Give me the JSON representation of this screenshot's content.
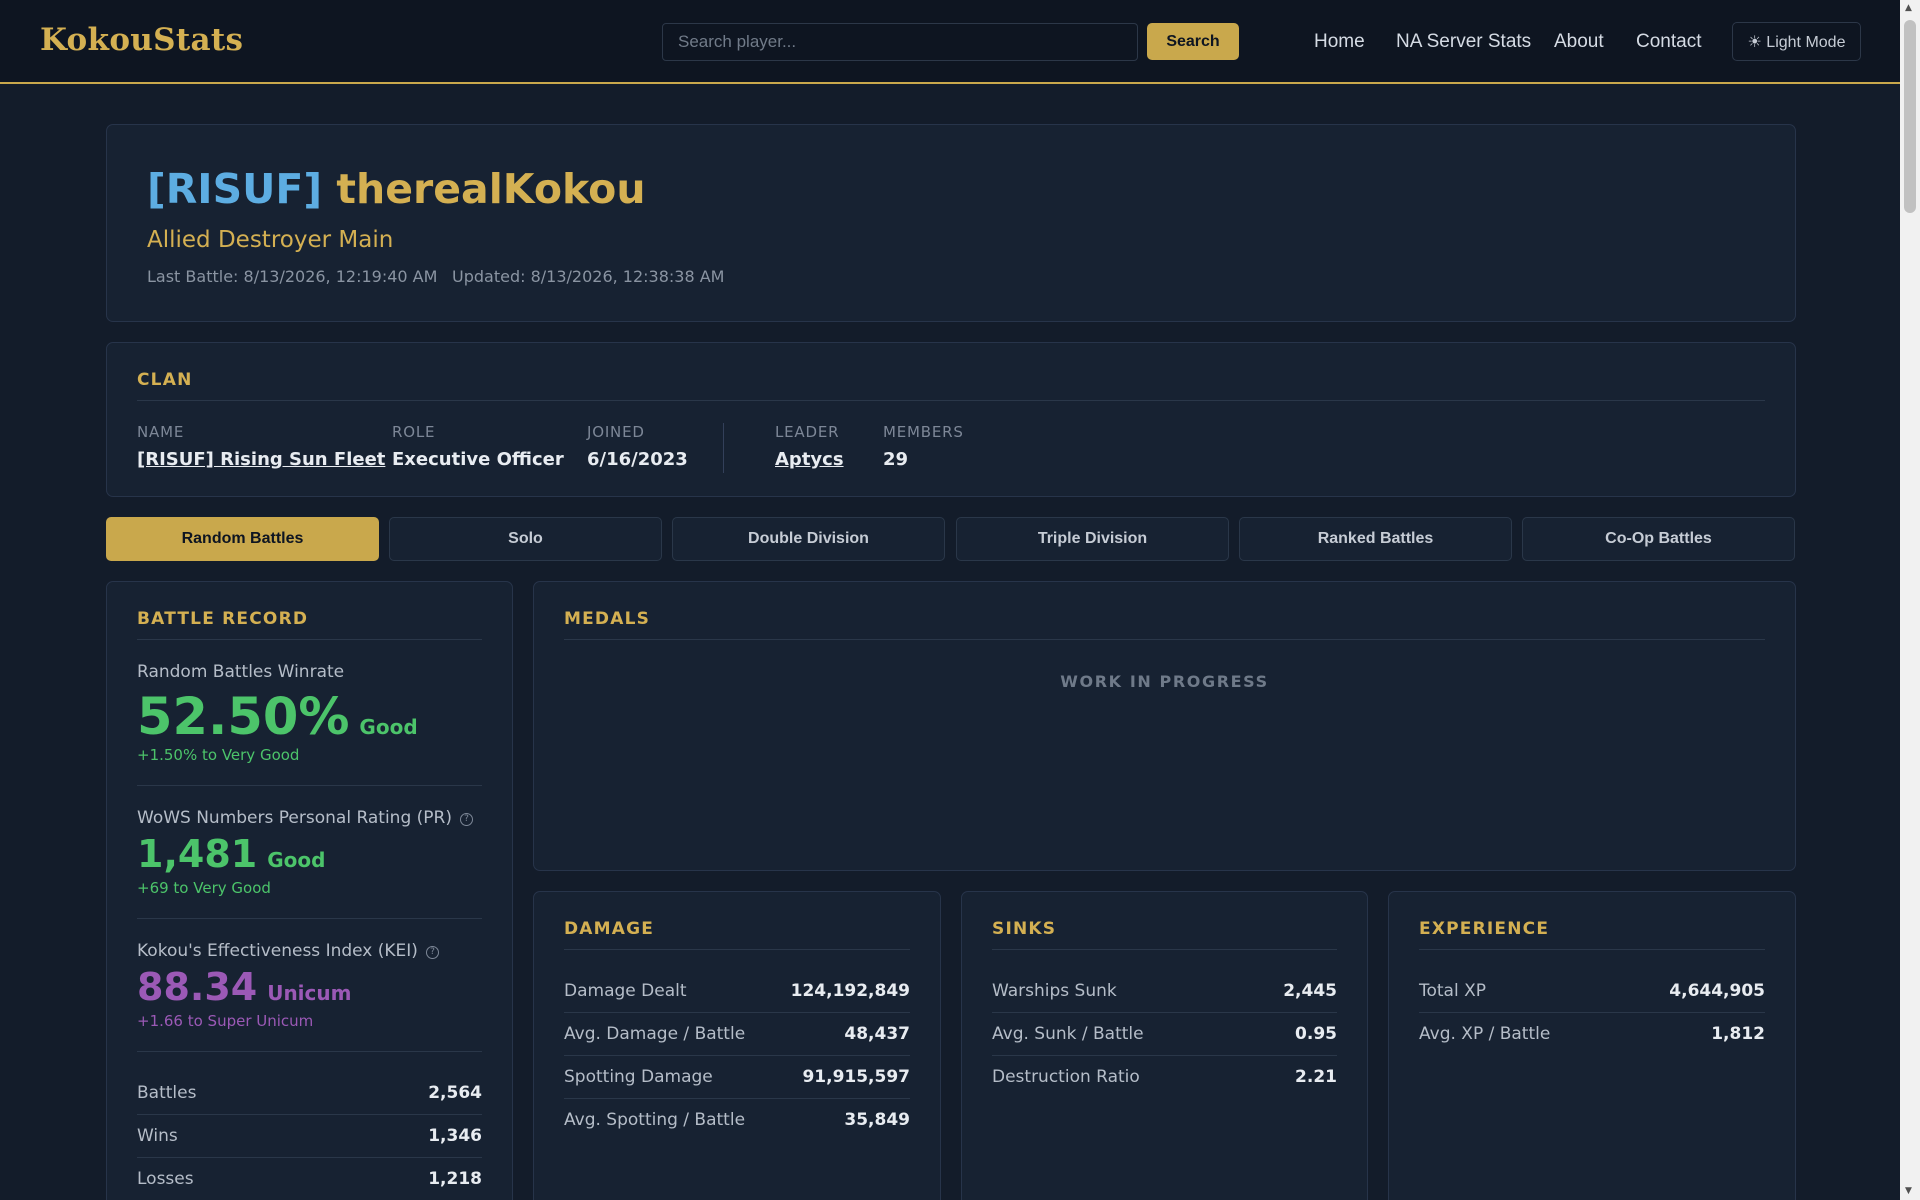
{
  "brand": "KokouStats",
  "search": {
    "placeholder": "Search player...",
    "button": "Search"
  },
  "nav": {
    "home": "Home",
    "na_stats": "NA Server Stats",
    "about": "About",
    "contact": "Contact"
  },
  "theme_toggle": "☀ Light Mode",
  "player": {
    "clan_tag": "[RISUF]",
    "name": "therealKokou",
    "subtitle": "Allied Destroyer Main",
    "last_battle": "Last Battle: 8/13/2026, 12:19:40 AM",
    "updated": "Updated: 8/13/2026, 12:38:38 AM"
  },
  "clan": {
    "title": "CLAN",
    "name_label": "NAME",
    "name": "[RISUF] Rising Sun Fleet",
    "role_label": "ROLE",
    "role": "Executive Officer",
    "joined_label": "JOINED",
    "joined": "6/16/2023",
    "leader_label": "LEADER",
    "leader": "Aptycs",
    "members_label": "MEMBERS",
    "members": "29"
  },
  "tabs": [
    "Random Battles",
    "Solo",
    "Double Division",
    "Triple Division",
    "Ranked Battles",
    "Co-Op Battles"
  ],
  "active_tab": "Random Battles",
  "battle_record": {
    "title": "BATTLE RECORD",
    "winrate_label": "Random Battles Winrate",
    "winrate": "52.50%",
    "winrate_rating": "Good",
    "winrate_next": "+1.50% to Very Good",
    "pr_label": "WoWS Numbers Personal Rating (PR)",
    "pr": "1,481",
    "pr_rating": "Good",
    "pr_next": "+69 to Very Good",
    "kei_label": "Kokou's Effectiveness Index (KEI)",
    "kei": "88.34",
    "kei_rating": "Unicum",
    "kei_next": "+1.66 to Super Unicum",
    "rows": [
      {
        "label": "Battles",
        "value": "2,564"
      },
      {
        "label": "Wins",
        "value": "1,346"
      },
      {
        "label": "Losses",
        "value": "1,218"
      }
    ]
  },
  "medals": {
    "title": "MEDALS",
    "status": "WORK IN PROGRESS"
  },
  "damage": {
    "title": "DAMAGE",
    "rows": [
      {
        "label": "Damage Dealt",
        "value": "124,192,849"
      },
      {
        "label": "Avg. Damage / Battle",
        "value": "48,437"
      },
      {
        "label": "Spotting Damage",
        "value": "91,915,597"
      },
      {
        "label": "Avg. Spotting / Battle",
        "value": "35,849"
      }
    ]
  },
  "sinks": {
    "title": "SINKS",
    "rows": [
      {
        "label": "Warships Sunk",
        "value": "2,445"
      },
      {
        "label": "Avg. Sunk / Battle",
        "value": "0.95"
      },
      {
        "label": "Destruction Ratio",
        "value": "2.21"
      }
    ]
  },
  "experience": {
    "title": "EXPERIENCE",
    "rows": [
      {
        "label": "Total XP",
        "value": "4,644,905"
      },
      {
        "label": "Avg. XP / Battle",
        "value": "1,812"
      }
    ]
  },
  "colors": {
    "accent_gold": "#c9a84c",
    "clan_blue": "#5dade2",
    "good_green": "#4cc46a",
    "unicum_purple": "#9b59b6",
    "background": "#131c2a",
    "card": "#172232"
  },
  "icons": {
    "help": "help-circle-icon",
    "theme": "sun-icon"
  }
}
